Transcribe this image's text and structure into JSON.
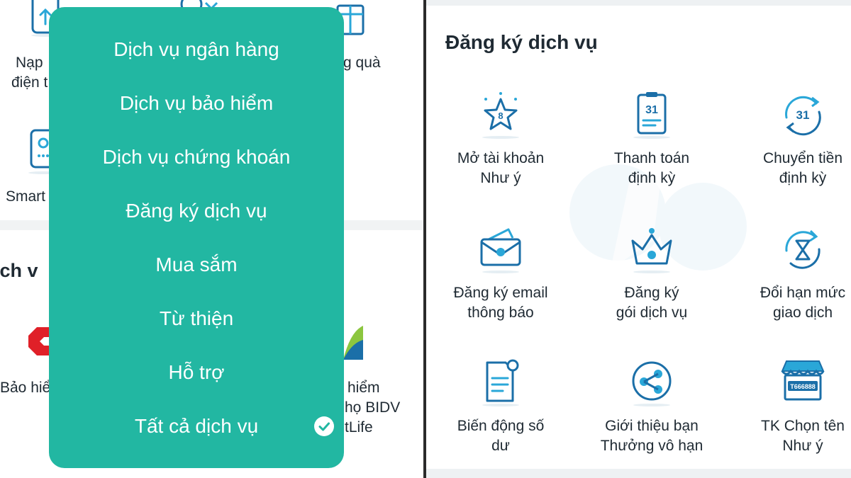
{
  "left_panel": {
    "labels": {
      "nap_line1": "Nạp",
      "nap_line2": "điện t",
      "qua": "g quà",
      "smart": "Smart",
      "heading": "ịch v",
      "bao_hiem": "Bảo hiể",
      "hiem": "hiểm",
      "bidv": "họ BIDV",
      "tlife": "tLife"
    }
  },
  "menu": {
    "items": [
      "Dịch vụ ngân hàng",
      "Dịch vụ bảo hiểm",
      "Dịch vụ chứng khoán",
      "Đăng ký dịch vụ",
      "Mua sắm",
      "Từ thiện",
      "Hỗ trợ",
      "Tất cả dịch vụ"
    ],
    "selected": "Tất cả dịch vụ"
  },
  "right_panel": {
    "title": "Đăng ký dịch vụ",
    "tiles": [
      {
        "line1": "Mở tài khoản",
        "line2": "Như ý",
        "icon": "star-8-icon"
      },
      {
        "line1": "Thanh toán",
        "line2": "định kỳ",
        "icon": "calendar-31-icon"
      },
      {
        "line1": "Chuyển tiền",
        "line2": "định kỳ",
        "icon": "recurring-transfer-icon"
      },
      {
        "line1": "Đăng ký email",
        "line2": "thông báo",
        "icon": "email-icon"
      },
      {
        "line1": "Đăng ký",
        "line2": "gói dịch vụ",
        "icon": "crown-icon"
      },
      {
        "line1": "Đổi hạn mức",
        "line2": "giao dịch",
        "icon": "limit-change-icon"
      },
      {
        "line1": "Biến động số",
        "line2": "dư",
        "icon": "balance-notification-icon"
      },
      {
        "line1": "Giới thiệu bạn",
        "line2": "Thưởng vô hạn",
        "icon": "share-icon"
      },
      {
        "line1": "TK Chọn tên",
        "line2": "Như ý",
        "icon": "shop-account-icon"
      }
    ],
    "shop_code": "T666888"
  },
  "colors": {
    "menu_bg": "#22b7a2",
    "icon_primary": "#1b6fa8",
    "icon_accent": "#2aa7d8",
    "brand_red": "#e02028"
  }
}
